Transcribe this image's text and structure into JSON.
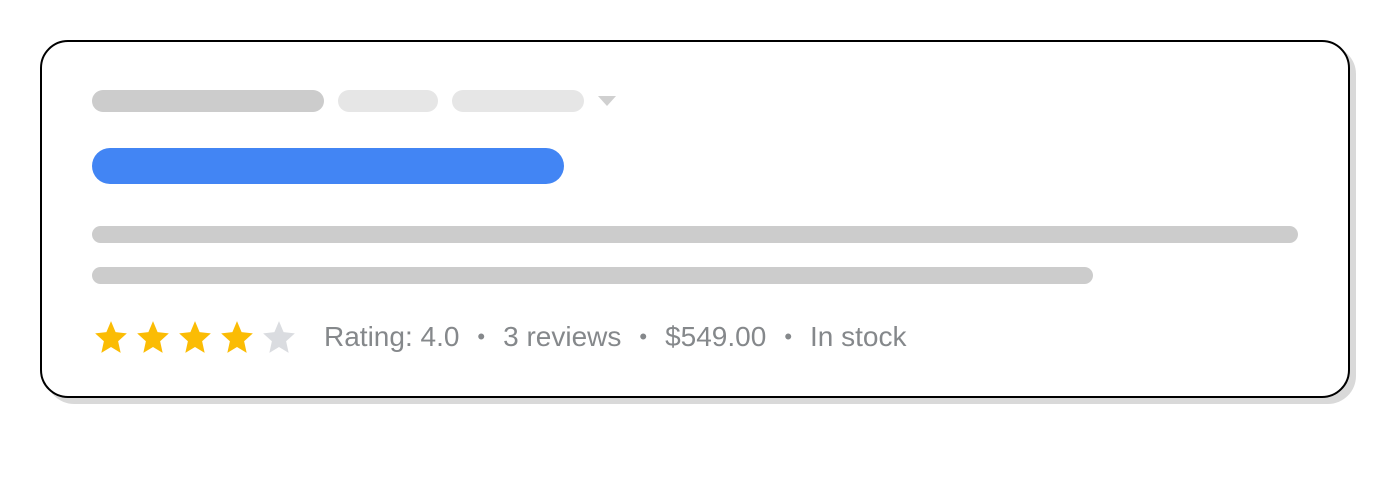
{
  "rating": {
    "label": "Rating: 4.0",
    "reviews": "3 reviews",
    "price": "$549.00",
    "stock": "In stock",
    "stars_filled": 4,
    "stars_total": 5
  }
}
